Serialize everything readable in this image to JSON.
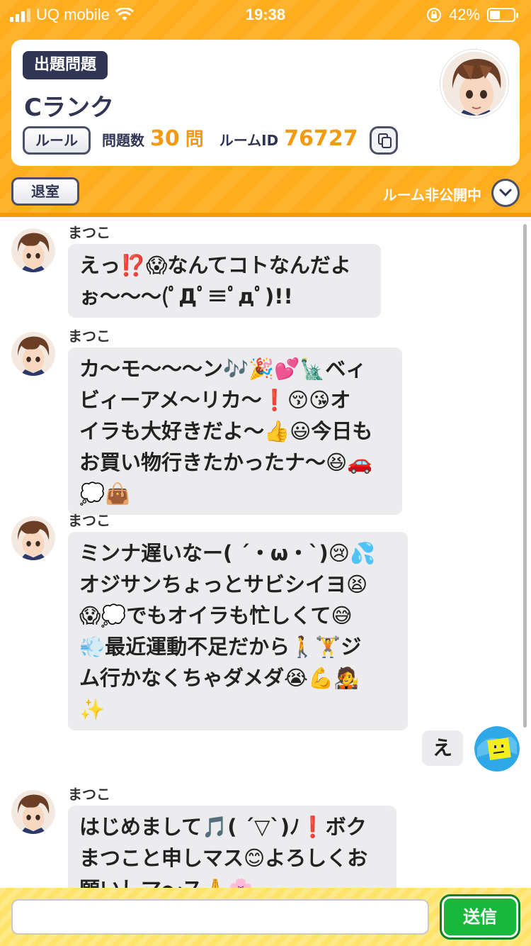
{
  "status_bar": {
    "carrier": "UQ mobile",
    "time": "19:38",
    "battery": "42%",
    "battery_level": 0.42
  },
  "room": {
    "tag": "出題問題",
    "rank": "Cランク",
    "rule_button": "ルール",
    "question_count_label": "問題数",
    "question_count": "30",
    "question_unit": "問",
    "room_id_label": "ルームID",
    "room_id": "76727"
  },
  "controls": {
    "exit_button": "退室",
    "visibility": "ルーム非公開中"
  },
  "messages": [
    {
      "sender": "まつこ",
      "lines": [
        "えっ⁉️😱なんてコトなんだよ",
        "ぉ〜〜〜(ﾟДﾟ≡ﾟдﾟ)!!"
      ]
    },
    {
      "sender": "まつこ",
      "lines": [
        "カ〜モ〜〜〜ン🎶🎉💕🗽ベィ",
        "ビィーアメ〜リカ〜❗️😚😘オ",
        "イラも大好きだよ〜👍😃今日も",
        "お買い物行きたかったナ〜😆🚗",
        "💭👜"
      ]
    },
    {
      "sender": "まつこ",
      "lines": [
        "ミンナ遅いなー( ´・ω・`)😢💦",
        "オジサンちょっとサビシイヨ😫",
        "😱💭でもオイラも忙しくて😅",
        "💨最近運動不足だから🚶🏋️ジ",
        "ム行かなくちゃダメダ😭💪🧑‍🎤",
        "✨"
      ]
    },
    {
      "sender": "me",
      "lines": [
        "え"
      ]
    },
    {
      "sender": "まつこ",
      "lines": [
        "はじめまして🎵( ´▽`)ﾉ❗️ボク",
        "まつこと申しマス😊よろしくお",
        "願いしマ〜ス🙏🌸"
      ]
    }
  ],
  "composer": {
    "placeholder": "",
    "send_button": "送信"
  },
  "colors": {
    "header": "#ffad1f",
    "accent_number": "#f29a12",
    "dark": "#2f3552",
    "bubble": "#ececee",
    "send": "#17b83c"
  }
}
